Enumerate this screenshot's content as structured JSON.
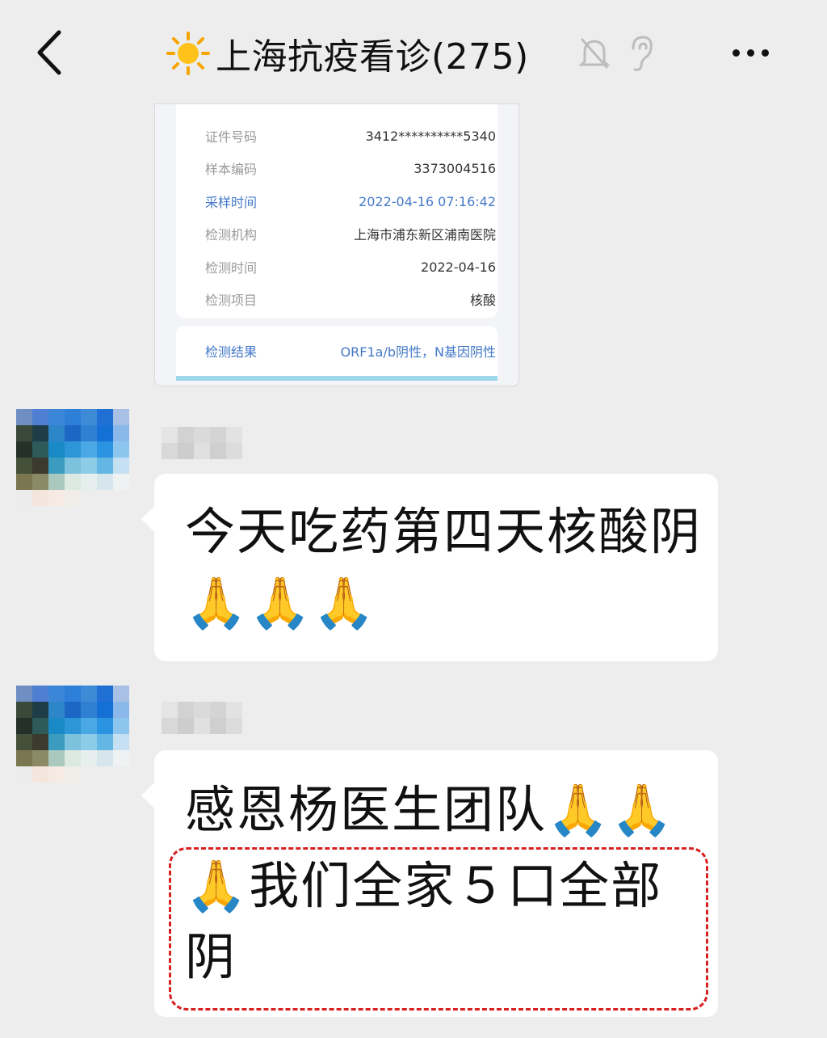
{
  "header": {
    "title": "上海抗疫看诊(275)",
    "icons": [
      "back-arrow-icon",
      "sun-icon",
      "mute-bell-icon",
      "ear-icon",
      "more-icon"
    ]
  },
  "report": {
    "rows": [
      {
        "label": "证件号码",
        "value": "3412**********5340",
        "highlight": false
      },
      {
        "label": "样本编码",
        "value": "3373004516",
        "highlight": false
      },
      {
        "label": "采样时间",
        "value": "2022-04-16 07:16:42",
        "highlight": true
      },
      {
        "label": "检测机构",
        "value": "上海市浦东新区浦南医院",
        "highlight": false
      },
      {
        "label": "检测时间",
        "value": "2022-04-16",
        "highlight": false
      },
      {
        "label": "检测项目",
        "value": "核酸",
        "highlight": false
      }
    ],
    "result": {
      "label": "检测结果",
      "value": "ORF1a/b阴性，N基因阴性"
    }
  },
  "messages": [
    {
      "text": "今天吃药第四天核酸阴🙏🙏🙏"
    },
    {
      "text_line1": "感恩杨医生团队🙏🙏",
      "text_line2": "🙏我们全家５口全部阴"
    }
  ],
  "colors": {
    "background": "#ededed",
    "highlight": "#4479c9",
    "dashed_border": "#d82020"
  }
}
